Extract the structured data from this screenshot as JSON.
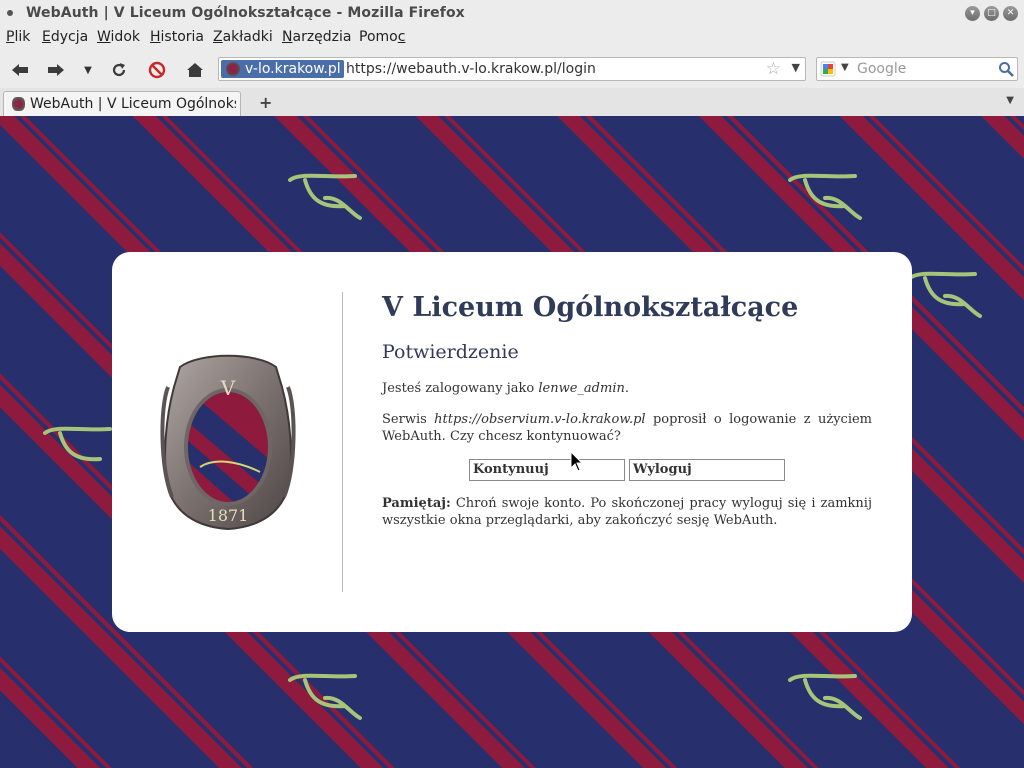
{
  "window": {
    "title": "WebAuth | V Liceum Ogólnokształcące - Mozilla Firefox",
    "buttons": [
      "minimize",
      "maximize",
      "close"
    ]
  },
  "menu": {
    "items": [
      {
        "label": "Plik",
        "mnemonic": "P"
      },
      {
        "label": "Edycja",
        "mnemonic": "E"
      },
      {
        "label": "Widok",
        "mnemonic": "W"
      },
      {
        "label": "Historia",
        "mnemonic": "H"
      },
      {
        "label": "Zakładki",
        "mnemonic": "Z"
      },
      {
        "label": "Narzędzia",
        "mnemonic": "N"
      },
      {
        "label": "Pomoc",
        "mnemonic": "c"
      }
    ]
  },
  "nav": {
    "identity": "v-lo.krakow.pl",
    "url": "https://webauth.v-lo.krakow.pl/login",
    "search_placeholder": "Google",
    "icons": [
      "back-icon",
      "forward-icon",
      "history-dropdown-icon",
      "reload-icon",
      "stop-icon",
      "home-icon",
      "bookmark-star-icon",
      "google-icon",
      "search-icon"
    ]
  },
  "tabs": {
    "items": [
      {
        "label": "WebAuth | V Liceum Ogólnoks..."
      }
    ],
    "new_tab": "+"
  },
  "page": {
    "heading": "V Liceum Ogólnokształcące",
    "subheading": "Potwierdzenie",
    "logged_prefix": "Jesteś zalogowany jako ",
    "username": "lenwe_admin",
    "logged_suffix": ".",
    "service_prefix": "Serwis ",
    "service_url": "https://observium.v-lo.krakow.pl",
    "service_suffix": " poprosił o logowanie z użyciem WebAuth. Czy chcesz kontynuować?",
    "continue_label": "Kontynuuj",
    "logout_label": "Wyloguj",
    "note_label": "Pamiętaj:",
    "note_text": " Chroń swoje konto. Po skończonej pracy wyloguj się i zamknij wszystkie okna przeglądarki, aby zakończyć sesję WebAuth.",
    "crest_year": "1871",
    "crest_letter": "V"
  },
  "colors": {
    "stripe_navy": "#272f6c",
    "stripe_maroon": "#8e1b3e",
    "heading": "#2f3b58",
    "identity_bg": "#4a6ea9",
    "signature": "#a6c47a"
  }
}
